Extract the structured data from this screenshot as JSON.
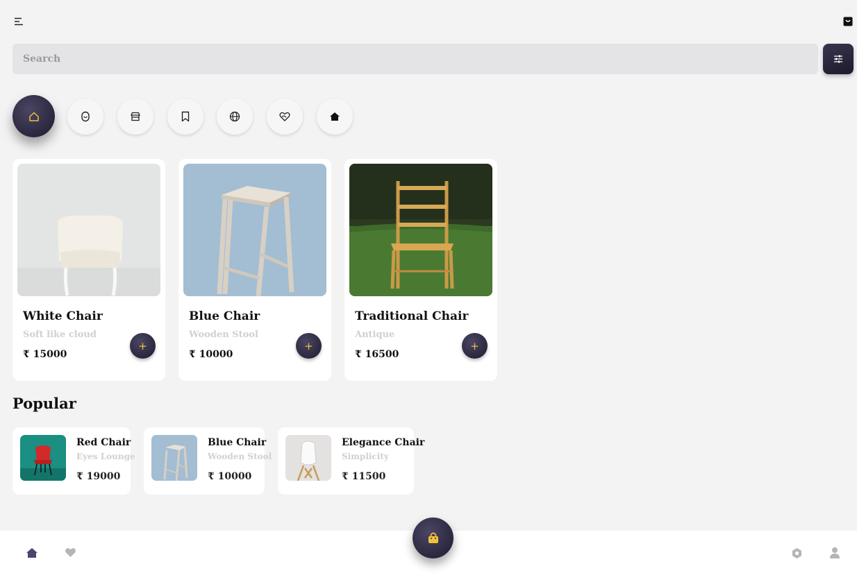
{
  "header": {
    "menu_icon": "menu-icon",
    "bag_icon": "shopping-bag-icon"
  },
  "search": {
    "placeholder": "Search",
    "filter_icon": "sliders-icon"
  },
  "categories": [
    {
      "icon": "home-icon",
      "active": true
    },
    {
      "icon": "mouse-icon"
    },
    {
      "icon": "store-icon"
    },
    {
      "icon": "bookmark-icon"
    },
    {
      "icon": "globe-icon"
    },
    {
      "icon": "heart-hand-icon"
    },
    {
      "icon": "home-filled-icon"
    }
  ],
  "products": [
    {
      "name": "White Chair",
      "subtitle": "Soft like cloud",
      "price": "₹ 15000",
      "add_label": "+"
    },
    {
      "name": "Blue Chair",
      "subtitle": "Wooden Stool",
      "price": "₹ 10000",
      "add_label": "+"
    },
    {
      "name": "Traditional Chair",
      "subtitle": "Antique",
      "price": "₹ 16500",
      "add_label": "+"
    }
  ],
  "popular": {
    "title": "Popular",
    "items": [
      {
        "name": "Red Chair",
        "subtitle": "Eyes Lounge",
        "price": "₹ 19000"
      },
      {
        "name": "Blue Chair",
        "subtitle": "Wooden Stool",
        "price": "₹ 10000"
      },
      {
        "name": "Elegance Chair",
        "subtitle": "Simplicity",
        "price": "₹ 11500"
      }
    ]
  },
  "bottom_nav": {
    "items": [
      "home-icon",
      "heart-icon",
      "cart-icon",
      "settings-icon",
      "profile-icon"
    ]
  },
  "colors": {
    "accent": "#f0c03a",
    "dark": "#2a2640",
    "background": "#f3f3f3",
    "muted": "#d0d0d3"
  }
}
